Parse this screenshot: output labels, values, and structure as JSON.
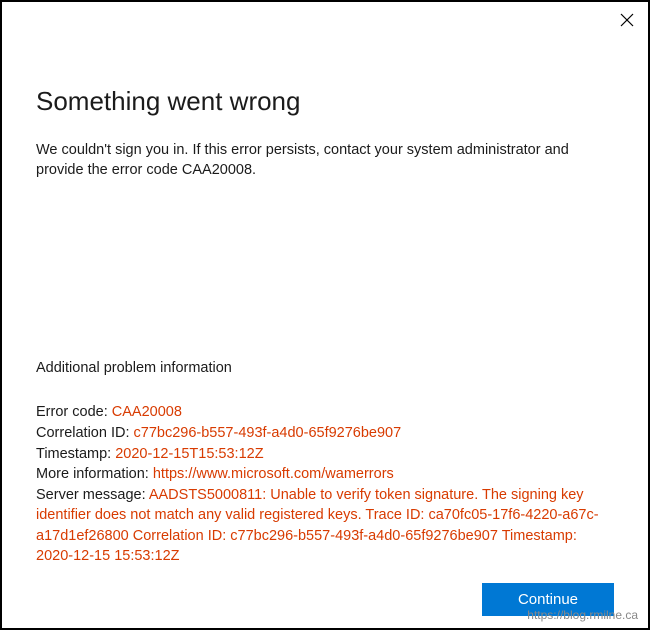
{
  "titlebar": {
    "close_icon": "close"
  },
  "heading": "Something went wrong",
  "subtitle": "We couldn't sign you in. If this error persists, contact your system administrator and provide the error code CAA20008.",
  "additional_label": "Additional problem information",
  "details": {
    "error_code_label": "Error code: ",
    "error_code_value": "CAA20008",
    "correlation_label": "Correlation ID: ",
    "correlation_value": "c77bc296-b557-493f-a4d0-65f9276be907",
    "timestamp_label": "Timestamp: ",
    "timestamp_value": "2020-12-15T15:53:12Z",
    "moreinfo_label": "More information: ",
    "moreinfo_value": "https://www.microsoft.com/wamerrors",
    "server_label": "Server message: ",
    "server_value": "AADSTS5000811: Unable to verify token signature. The signing key identifier does not match any valid registered keys. Trace ID: ca70fc05-17f6-4220-a67c-a17d1ef26800 Correlation ID: c77bc296-b557-493f-a4d0-65f9276be907 Timestamp: 2020-12-15 15:53:12Z"
  },
  "continue_label": "Continue",
  "watermark": "https://blog.rmilne.ca"
}
